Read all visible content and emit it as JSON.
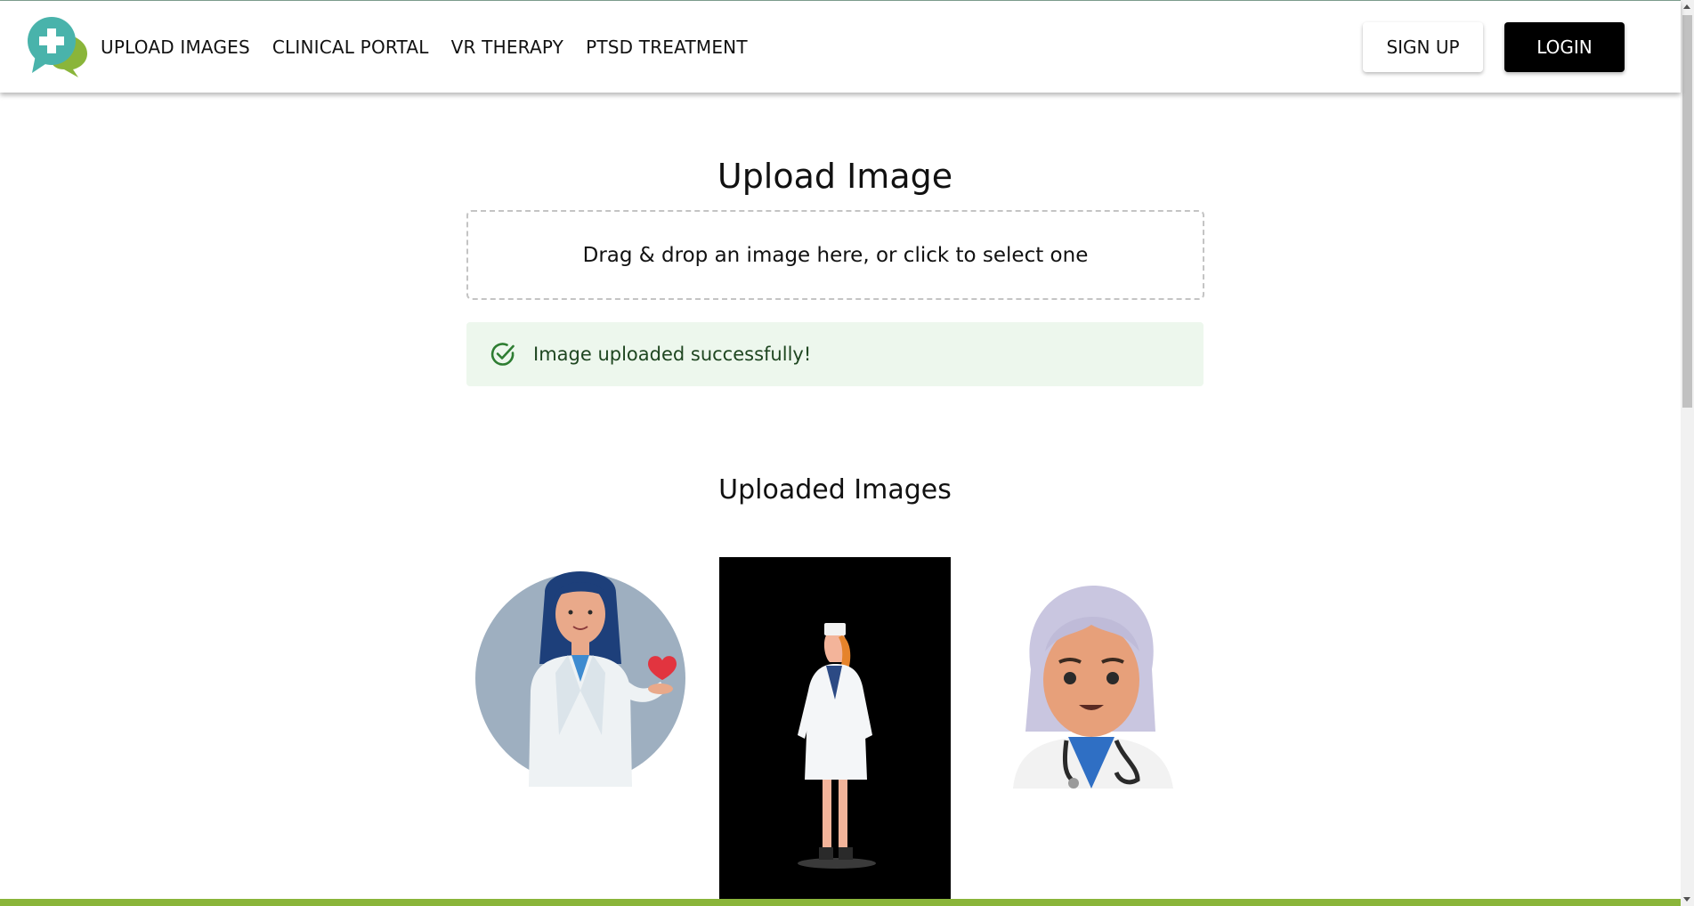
{
  "nav": {
    "items": [
      {
        "label": "UPLOAD IMAGES"
      },
      {
        "label": "CLINICAL PORTAL"
      },
      {
        "label": "VR THERAPY"
      },
      {
        "label": "PTSD TREATMENT"
      }
    ]
  },
  "auth": {
    "signup_label": "SIGN UP",
    "login_label": "LOGIN"
  },
  "upload": {
    "title": "Upload Image",
    "dropzone_text": "Drag & drop an image here, or click to select one",
    "success_message": "Image uploaded successfully!"
  },
  "gallery": {
    "title": "Uploaded Images",
    "images": [
      {
        "icon": "doctor-woman-heart-illustration"
      },
      {
        "icon": "nurse-standing-illustration"
      },
      {
        "icon": "doctor-3d-avatar-illustration"
      }
    ]
  },
  "colors": {
    "brand_teal": "#49b3ab",
    "brand_green": "#8ab53a",
    "success_bg": "#edf7ed",
    "success_icon": "#2e7d32",
    "login_bg": "#000000"
  }
}
